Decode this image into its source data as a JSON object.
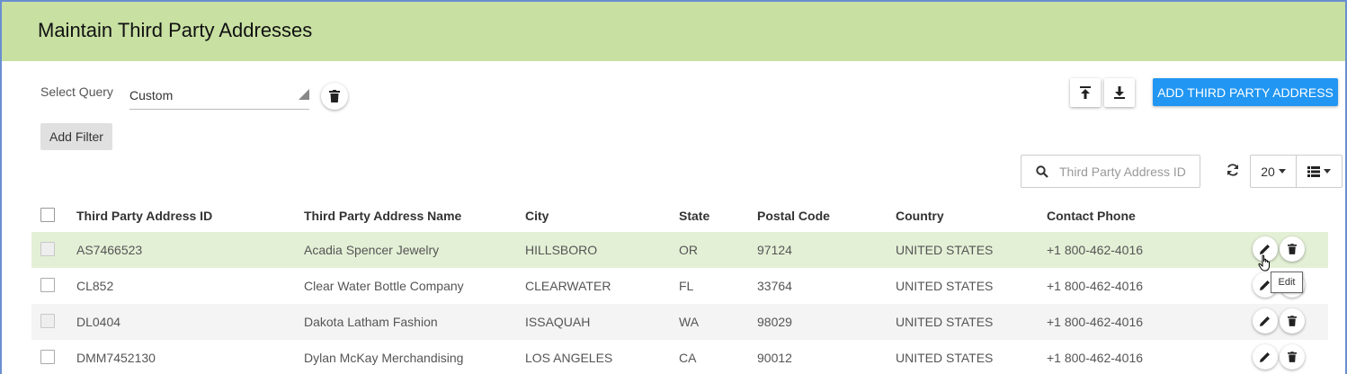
{
  "header": {
    "title": "Maintain Third Party Addresses"
  },
  "query": {
    "label": "Select Query",
    "selected": "Custom"
  },
  "buttons": {
    "add": "ADD THIRD PARTY ADDRESS",
    "add_filter": "Add Filter"
  },
  "search": {
    "placeholder": "Third Party Address ID"
  },
  "pagination": {
    "page_size": "20"
  },
  "columns": [
    "Third Party Address ID",
    "Third Party Address Name",
    "City",
    "State",
    "Postal Code",
    "Country",
    "Contact Phone"
  ],
  "rows": [
    {
      "id": "AS7466523",
      "name": "Acadia Spencer Jewelry",
      "city": "HILLSBORO",
      "state": "OR",
      "postal": "97124",
      "country": "UNITED STATES",
      "phone": "+1 800-462-4016"
    },
    {
      "id": "CL852",
      "name": "Clear Water Bottle Company",
      "city": "CLEARWATER",
      "state": "FL",
      "postal": "33764",
      "country": "UNITED STATES",
      "phone": "+1 800-462-4016"
    },
    {
      "id": "DL0404",
      "name": "Dakota Latham Fashion",
      "city": "ISSAQUAH",
      "state": "WA",
      "postal": "98029",
      "country": "UNITED STATES",
      "phone": "+1 800-462-4016"
    },
    {
      "id": "DMM7452130",
      "name": "Dylan McKay Merchandising",
      "city": "LOS ANGELES",
      "state": "CA",
      "postal": "90012",
      "country": "UNITED STATES",
      "phone": "+1 800-462-4016"
    }
  ],
  "tooltip": "Edit",
  "colors": {
    "header_bg": "#c8e0a2",
    "primary": "#2196f3",
    "hover_row": "#e4f0d6"
  }
}
